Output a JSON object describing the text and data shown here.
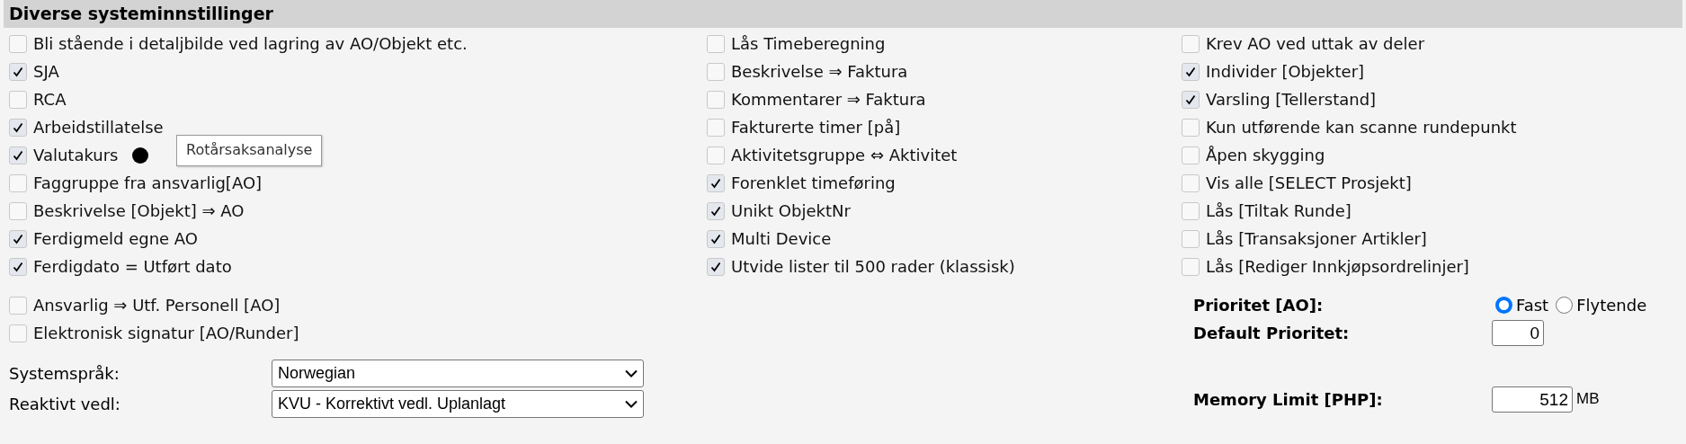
{
  "section": {
    "title": "Diverse systeminnstillinger"
  },
  "columns": [
    [
      {
        "label": "Bli stående i detaljbilde ved lagring av AO/Objekt etc.",
        "checked": false
      },
      {
        "label": "SJA",
        "checked": true
      },
      {
        "label": "RCA",
        "checked": false
      },
      {
        "label": "Arbeidstillatelse",
        "checked": true
      },
      {
        "label": "Valutakurs",
        "checked": true,
        "info": true
      },
      {
        "label": "Faggruppe fra ansvarlig[AO]",
        "checked": false
      },
      {
        "label": "Beskrivelse [Objekt] ⇒ AO",
        "checked": false
      },
      {
        "label": "Ferdigmeld egne AO",
        "checked": true
      },
      {
        "label": "Ferdigdato = Utført dato",
        "checked": true
      }
    ],
    [
      {
        "label": "Lås Timeberegning",
        "checked": false
      },
      {
        "label": "Beskrivelse ⇒ Faktura",
        "checked": false
      },
      {
        "label": "Kommentarer ⇒ Faktura",
        "checked": false
      },
      {
        "label": "Fakturerte timer [på]",
        "checked": false
      },
      {
        "label": "Aktivitetsgruppe ⇔ Aktivitet",
        "checked": false
      },
      {
        "label": "Forenklet timeføring",
        "checked": true
      },
      {
        "label": "Unikt ObjektNr",
        "checked": true
      },
      {
        "label": "Multi Device",
        "checked": true
      },
      {
        "label": "Utvide lister til 500 rader (klassisk)",
        "checked": true
      }
    ],
    [
      {
        "label": "Krev AO ved uttak av deler",
        "checked": false
      },
      {
        "label": "Individer [Objekter]",
        "checked": true
      },
      {
        "label": "Varsling [Tellerstand]",
        "checked": true
      },
      {
        "label": "Kun utførende kan scanne rundepunkt",
        "checked": false
      },
      {
        "label": "Åpen skygging",
        "checked": false
      },
      {
        "label": "Vis alle [SELECT Prosjekt]",
        "checked": false
      },
      {
        "label": "Lås [Tiltak Runde]",
        "checked": false
      },
      {
        "label": "Lås [Transaksjoner Artikler]",
        "checked": false
      },
      {
        "label": "Lås [Rediger Innkjøpsordrelinjer]",
        "checked": false
      }
    ]
  ],
  "tooltip": {
    "text": "Rotårsaksanalyse"
  },
  "extra_checkboxes": [
    {
      "label": "Ansvarlig ⇒ Utf. Personell [AO]",
      "checked": false
    },
    {
      "label": "Elektronisk signatur [AO/Runder]",
      "checked": false
    }
  ],
  "selects": [
    {
      "label": "Systemspråk:",
      "value": "Norwegian"
    },
    {
      "label": "Reaktivt vedl:",
      "value": "KVU - Korrektivt vedl. Uplanlagt"
    }
  ],
  "priority": {
    "label": "Prioritet [AO]:",
    "options": [
      {
        "label": "Fast",
        "selected": true
      },
      {
        "label": "Flytende",
        "selected": false
      }
    ]
  },
  "default_priority": {
    "label": "Default Prioritet:",
    "value": "0"
  },
  "memory_limit": {
    "label": "Memory Limit [PHP]:",
    "value": "512",
    "unit": "MB"
  }
}
